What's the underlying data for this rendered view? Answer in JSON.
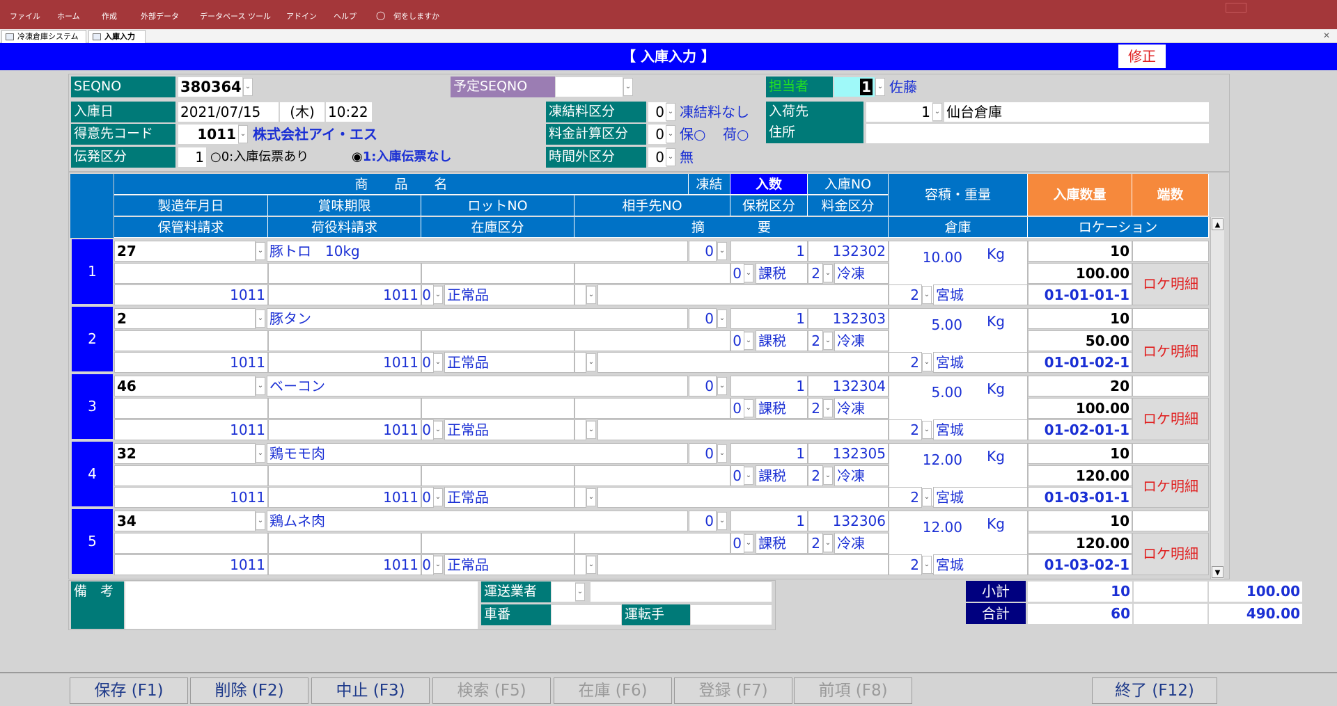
{
  "ribbon": {
    "menus": [
      "ファイル",
      "ホーム",
      "作成",
      "外部データ",
      "データベース ツール",
      "アドイン",
      "ヘルプ",
      "何をしますか"
    ]
  },
  "doc_tabs": [
    "冷凍倉庫システム",
    "入庫入力"
  ],
  "form": {
    "title": "【 入庫入力 】",
    "mode_label": "修正",
    "seqno_label": "SEQNO",
    "seqno": "380364",
    "planned_seqno_label": "予定SEQNO",
    "planned_seqno": "",
    "staff_label": "担当者",
    "staff_code": "1",
    "staff_name": "佐藤",
    "receipt_date_label": "入庫日",
    "receipt_date": "2021/07/15",
    "receipt_weekday": "(木)",
    "receipt_time": "10:22",
    "freeze_fee_label": "凍結料区分",
    "freeze_fee_code": "0",
    "freeze_fee_text": "凍結料なし",
    "shipper_label": "入荷先",
    "shipper_code": "1",
    "shipper_name": "仙台倉庫",
    "client_code_label": "得意先コード",
    "client_code": "1011",
    "client_name": "株式会社アイ・エス",
    "fee_calc_label": "料金計算区分",
    "fee_calc_code": "0",
    "fee_calc_text1": "保○",
    "fee_calc_text2": "荷○",
    "address_label": "住所",
    "address": "",
    "slip_label": "伝発区分",
    "slip_code": "1",
    "slip_option0": "0:入庫伝票あり",
    "slip_option1": "1:入庫伝票なし",
    "overtime_label": "時間外区分",
    "overtime_code": "0",
    "overtime_text": "無"
  },
  "grid_headers": {
    "product_name": "商　　品　　名",
    "freeze": "凍結",
    "qty": "入数",
    "receipt_no": "入庫NO",
    "volume_weight": "容積・重量",
    "receipt_qty": "入庫数量",
    "fraction": "端数",
    "mfg_date": "製造年月日",
    "best_before": "賞味期限",
    "lot_no": "ロットNO",
    "partner_no": "相手先NO",
    "tax_class": "保税区分",
    "fee_class": "料金区分",
    "storage_billing": "保管料請求",
    "handling_billing": "荷役料請求",
    "stock_class": "在庫区分",
    "summary": "摘　　　　要",
    "warehouse": "倉庫",
    "location": "ロケーション"
  },
  "rows": [
    {
      "no": "1",
      "code": "27",
      "name": "豚トロ　10kg",
      "freeze": "0",
      "qty": "1",
      "receipt_no": "132302",
      "tax_code": "0",
      "tax": "課税",
      "fee_code": "2",
      "fee": "冷凍",
      "storage": "1011",
      "handling": "1011",
      "stock_code": "0",
      "stock": "正常品",
      "volume": "10.00",
      "unit": "Kg",
      "wh_code": "2",
      "wh": "宮城",
      "recv_qty": "10",
      "recv_weight": "100.00",
      "loc_btn": "ロケ明細",
      "location": "01-01-01-1"
    },
    {
      "no": "2",
      "code": "2",
      "name": "豚タン",
      "freeze": "0",
      "qty": "1",
      "receipt_no": "132303",
      "tax_code": "0",
      "tax": "課税",
      "fee_code": "2",
      "fee": "冷凍",
      "storage": "1011",
      "handling": "1011",
      "stock_code": "0",
      "stock": "正常品",
      "volume": "5.00",
      "unit": "Kg",
      "wh_code": "2",
      "wh": "宮城",
      "recv_qty": "10",
      "recv_weight": "50.00",
      "loc_btn": "ロケ明細",
      "location": "01-01-02-1"
    },
    {
      "no": "3",
      "code": "46",
      "name": "ベーコン",
      "freeze": "0",
      "qty": "1",
      "receipt_no": "132304",
      "tax_code": "0",
      "tax": "課税",
      "fee_code": "2",
      "fee": "冷凍",
      "storage": "1011",
      "handling": "1011",
      "stock_code": "0",
      "stock": "正常品",
      "volume": "5.00",
      "unit": "Kg",
      "wh_code": "2",
      "wh": "宮城",
      "recv_qty": "20",
      "recv_weight": "100.00",
      "loc_btn": "ロケ明細",
      "location": "01-02-01-1"
    },
    {
      "no": "4",
      "code": "32",
      "name": "鶏モモ肉",
      "freeze": "0",
      "qty": "1",
      "receipt_no": "132305",
      "tax_code": "0",
      "tax": "課税",
      "fee_code": "2",
      "fee": "冷凍",
      "storage": "1011",
      "handling": "1011",
      "stock_code": "0",
      "stock": "正常品",
      "volume": "12.00",
      "unit": "Kg",
      "wh_code": "2",
      "wh": "宮城",
      "recv_qty": "10",
      "recv_weight": "120.00",
      "loc_btn": "ロケ明細",
      "location": "01-03-01-1"
    },
    {
      "no": "5",
      "code": "34",
      "name": "鶏ムネ肉",
      "freeze": "0",
      "qty": "1",
      "receipt_no": "132306",
      "tax_code": "0",
      "tax": "課税",
      "fee_code": "2",
      "fee": "冷凍",
      "storage": "1011",
      "handling": "1011",
      "stock_code": "0",
      "stock": "正常品",
      "volume": "12.00",
      "unit": "Kg",
      "wh_code": "2",
      "wh": "宮城",
      "recv_qty": "10",
      "recv_weight": "120.00",
      "loc_btn": "ロケ明細",
      "location": "01-03-02-1"
    }
  ],
  "footer": {
    "remarks_label": "備　考",
    "remarks": "",
    "carrier_label": "運送業者",
    "carrier": "",
    "vehicle_label": "車番",
    "vehicle": "",
    "driver_label": "運転手",
    "driver": "",
    "subtotal_label": "小計",
    "subtotal_qty": "10",
    "subtotal_weight": "100.00",
    "total_label": "合計",
    "total_qty": "60",
    "total_weight": "490.00"
  },
  "fkeys": [
    {
      "label": "保存 (F1)",
      "enabled": true
    },
    {
      "label": "削除 (F2)",
      "enabled": true
    },
    {
      "label": "中止 (F3)",
      "enabled": true
    },
    {
      "label": "検索 (F5)",
      "enabled": false
    },
    {
      "label": "在庫 (F6)",
      "enabled": false
    },
    {
      "label": "登録 (F7)",
      "enabled": false
    },
    {
      "label": "前項 (F8)",
      "enabled": false
    },
    {
      "label": "終了 (F12)",
      "enabled": true
    }
  ],
  "colors": {
    "title_bar": "#0000ff",
    "ribbon": "#a4373a",
    "label_teal": "#007a78",
    "header_blue": "#0072c6",
    "accent_orange": "#f6893c"
  }
}
